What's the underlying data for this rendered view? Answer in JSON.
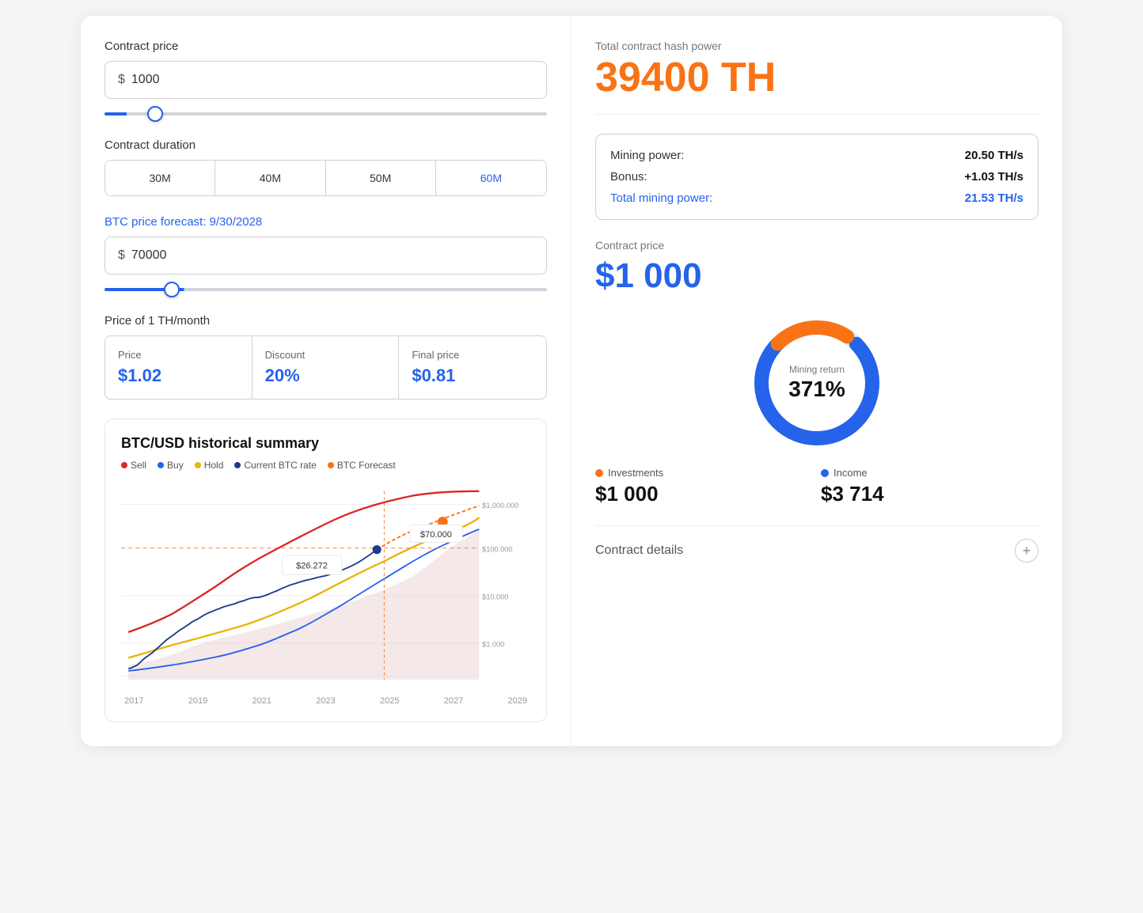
{
  "left": {
    "contractPrice": {
      "label": "Contract price",
      "currency": "$",
      "value": "1000",
      "sliderMin": 0,
      "sliderMax": 10000,
      "sliderVal": 1000
    },
    "contractDuration": {
      "label": "Contract duration",
      "buttons": [
        "30M",
        "40M",
        "50M",
        "60M"
      ],
      "activeIndex": 3
    },
    "btcForecast": {
      "labelPrefix": "BTC price forecast: ",
      "labelDate": "9/30/2028",
      "currency": "$",
      "value": "70000",
      "sliderMin": 0,
      "sliderMax": 500000,
      "sliderVal": 70000
    },
    "thPrice": {
      "label": "Price of 1 TH/month",
      "price": {
        "label": "Price",
        "value": "$1.02"
      },
      "discount": {
        "label": "Discount",
        "value": "20%"
      },
      "finalPrice": {
        "label": "Final price",
        "value": "$0.81"
      }
    },
    "chart": {
      "title": "BTC/USD historical summary",
      "legend": [
        {
          "label": "Sell",
          "color": "#dc2626"
        },
        {
          "label": "Buy",
          "color": "#2563eb"
        },
        {
          "label": "Hold",
          "color": "#eab308"
        },
        {
          "label": "Current BTC rate",
          "color": "#1e3a8a"
        },
        {
          "label": "BTC Forecast",
          "color": "#f97316"
        }
      ],
      "xLabels": [
        "2017",
        "2019",
        "2021",
        "2023",
        "2025",
        "2027",
        "2029"
      ],
      "yLabels": [
        "$1,000,000",
        "$100,000",
        "$10,000",
        "$1,000"
      ],
      "priceLabel1": "$26.272",
      "priceLabel2": "$70.000"
    }
  },
  "right": {
    "hashPower": {
      "label": "Total contract hash power",
      "value": "39400 TH"
    },
    "miningStats": {
      "miningPower": {
        "label": "Mining power:",
        "value": "20.50 TH/s"
      },
      "bonus": {
        "label": "Bonus:",
        "value": "+1.03 TH/s"
      },
      "totalMiningPower": {
        "label": "Total mining power:",
        "value": "21.53 TH/s"
      }
    },
    "contractPrice": {
      "label": "Contract price",
      "value": "$1 000"
    },
    "donut": {
      "centerLabel": "Mining return",
      "centerValue": "371%",
      "investColor": "#f97316",
      "incomeColor": "#2563eb"
    },
    "investments": {
      "label": "Investments",
      "color": "#f97316",
      "value": "$1 000"
    },
    "income": {
      "label": "Income",
      "color": "#2563eb",
      "value": "$3 714"
    },
    "contractDetails": {
      "label": "Contract details"
    }
  }
}
